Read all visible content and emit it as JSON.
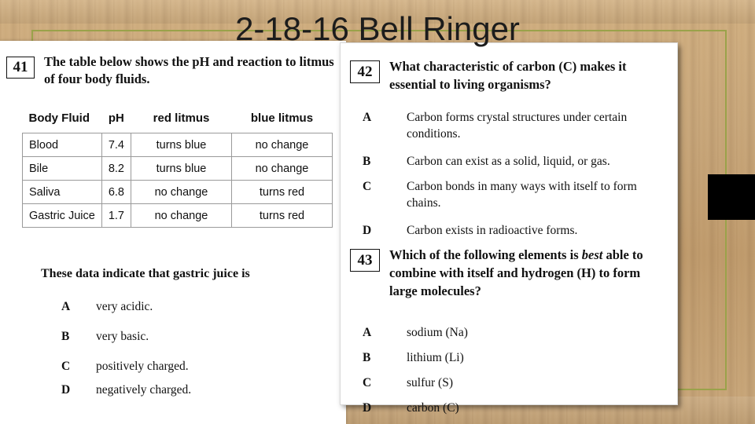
{
  "slide": {
    "title": "2-18-16 Bell Ringer"
  },
  "left": {
    "question_number": "41",
    "stem": "The table below shows the pH and reaction to litmus of four body fluids.",
    "table": {
      "headers": [
        "Body Fluid",
        "pH",
        "red litmus",
        "blue litmus"
      ],
      "rows": [
        [
          "Blood",
          "7.4",
          "turns blue",
          "no change"
        ],
        [
          "Bile",
          "8.2",
          "turns blue",
          "no change"
        ],
        [
          "Saliva",
          "6.8",
          "no change",
          "turns red"
        ],
        [
          "Gastric Juice",
          "1.7",
          "no change",
          "turns red"
        ]
      ]
    },
    "prompt": "These data indicate that gastric juice is",
    "options": [
      {
        "letter": "A",
        "text": "very acidic."
      },
      {
        "letter": "B",
        "text": "very basic."
      },
      {
        "letter": "C",
        "text": "positively charged."
      },
      {
        "letter": "D",
        "text": "negatively charged."
      }
    ]
  },
  "right": {
    "q42": {
      "question_number": "42",
      "stem": "What characteristic of carbon (C) makes it essential to living organisms?",
      "options": [
        {
          "letter": "A",
          "text": "Carbon forms crystal structures under certain conditions."
        },
        {
          "letter": "B",
          "text": "Carbon can exist as a solid, liquid, or gas."
        },
        {
          "letter": "C",
          "text": "Carbon bonds in many ways with itself to form chains."
        },
        {
          "letter": "D",
          "text": "Carbon exists in radioactive forms."
        }
      ]
    },
    "q43": {
      "question_number": "43",
      "stem_before": "Which of the following elements is ",
      "stem_italic": "best",
      "stem_after": " able to combine with itself and hydrogen (H) to form large molecules?",
      "options": [
        {
          "letter": "A",
          "text": "sodium (Na)"
        },
        {
          "letter": "B",
          "text": "lithium (Li)"
        },
        {
          "letter": "C",
          "text": "sulfur (S)"
        },
        {
          "letter": "D",
          "text": "carbon (C)"
        }
      ]
    }
  },
  "colors": {
    "frame": "#9aa24a",
    "background": "#c9a87c",
    "paper": "#ffffff",
    "text": "#111111"
  }
}
